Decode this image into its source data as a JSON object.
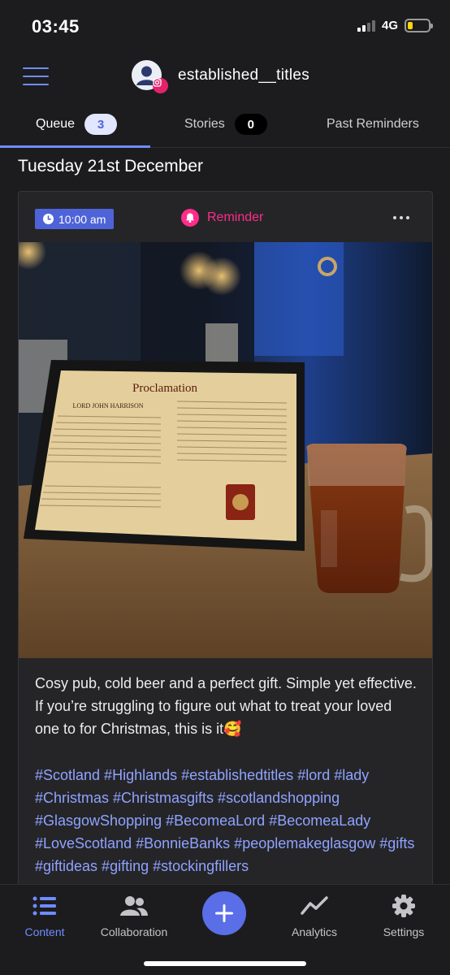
{
  "status_bar": {
    "time": "03:45",
    "network": "4G"
  },
  "header": {
    "account_name": "established__titles"
  },
  "tabs": [
    {
      "label": "Queue",
      "count": "3"
    },
    {
      "label": "Stories",
      "count": "0"
    },
    {
      "label": "Past Reminders"
    }
  ],
  "date_heading": "Tuesday 21st December",
  "post": {
    "time": "10:00 am",
    "type_label": "Reminder",
    "caption": "Cosy pub, cold beer and a perfect gift. Simple yet effective. If you’re struggling to figure out what to treat your loved one to for Christmas, this is it🥰",
    "hashtags": "#Scotland #Highlands #establishedtitles #lord #lady #Christmas #Christmasgifts #scotlandshopping #GlasgowShopping #BecomeaLord #BecomeaLady #LoveScotland #BonnieBanks #peoplemakeglasgow #gifts #giftideas #gifting #stockingfillers",
    "image": {
      "frame_title": "Proclamation",
      "frame_name": "LORD JOHN HARRISON"
    }
  },
  "bottom_nav": [
    {
      "label": "Content",
      "icon": "list-icon"
    },
    {
      "label": "Collaboration",
      "icon": "people-icon"
    },
    {
      "label": "",
      "icon": "plus-icon"
    },
    {
      "label": "Analytics",
      "icon": "trend-icon"
    },
    {
      "label": "Settings",
      "icon": "gear-icon"
    }
  ],
  "colors": {
    "accent": "#6f8cff",
    "chip": "#4f63d8",
    "reminder": "#ff2d8a",
    "background": "#1c1c1e"
  }
}
